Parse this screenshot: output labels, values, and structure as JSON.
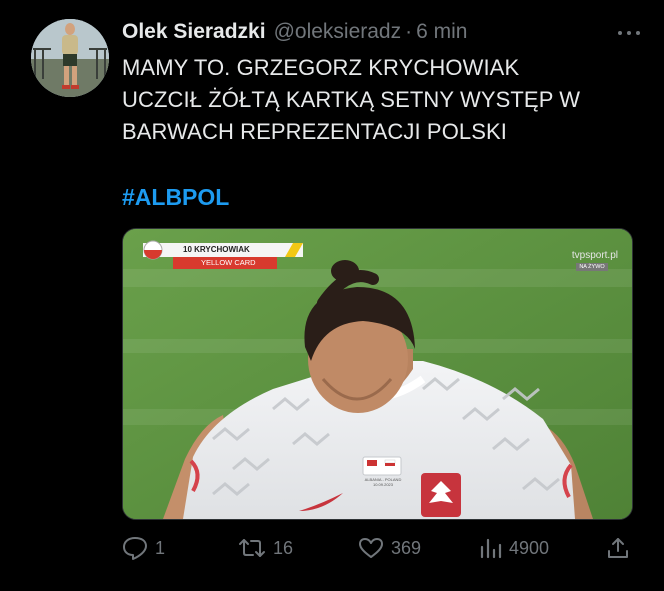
{
  "tweet": {
    "author_name": "Olek Sieradzki",
    "handle": "@oleksieradz",
    "separator": "·",
    "time": "6 min",
    "text_lines": [
      "MAMY TO. GRZEGORZ KRYCHOWIAK",
      "UCZCIŁ ŻÓŁTĄ KARTKĄ SETNY WYSTĘP W",
      "BARWACH REPREZENTACJI POLSKI"
    ],
    "hashtag": "#ALBPOL"
  },
  "media": {
    "graphic_player": "10 KRYCHOWIAK",
    "graphic_event": "YELLOW CARD",
    "broadcaster": "tvpsport.pl",
    "broadcaster_sub": "NA ŻYWO",
    "shirt_match": "ALBANIA - POLAND",
    "shirt_date": "10.09.2023"
  },
  "actions": {
    "replies": "1",
    "retweets": "16",
    "likes": "369",
    "views": "4900"
  },
  "icons": {
    "more": "more-dots-icon",
    "reply": "reply-icon",
    "retweet": "retweet-icon",
    "like": "heart-icon",
    "views": "views-icon",
    "share": "share-icon"
  },
  "colors": {
    "background": "#000000",
    "text": "#e7e9ea",
    "muted": "#71767b",
    "hashtag": "#1d9bf0"
  }
}
